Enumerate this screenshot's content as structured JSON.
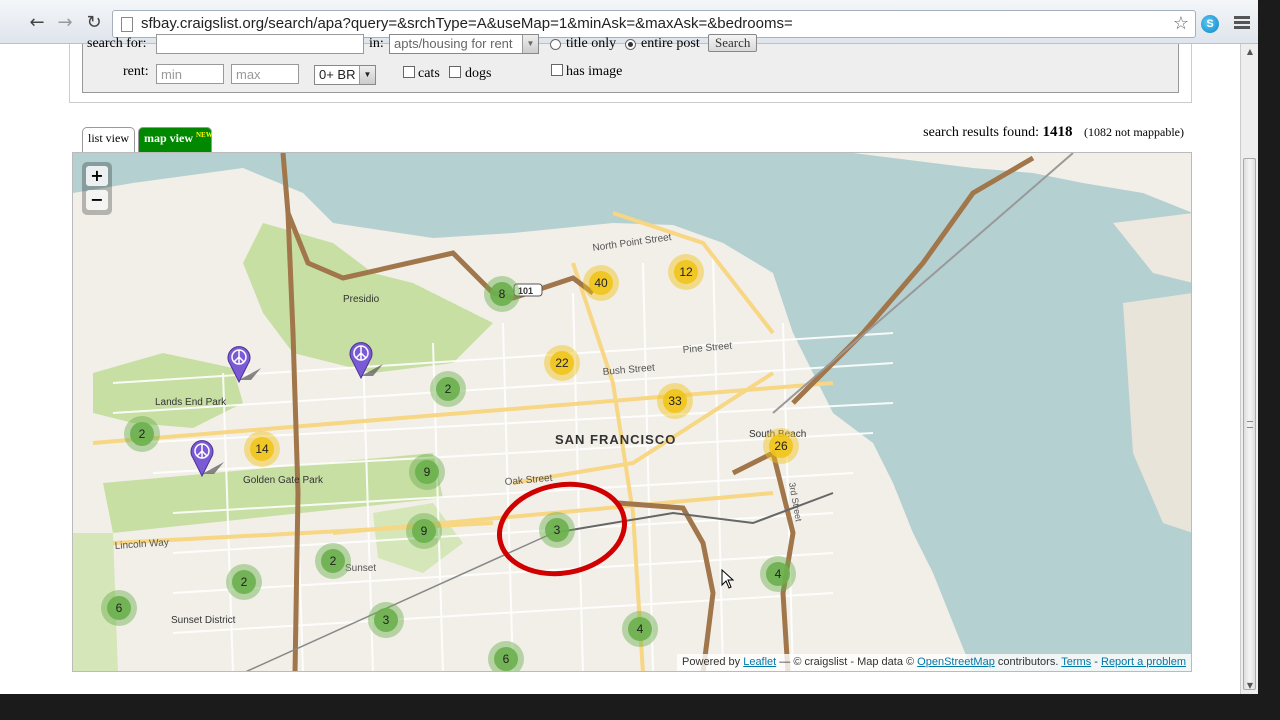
{
  "browser": {
    "url": "sfbay.craigslist.org/search/apa?query=&srchType=A&useMap=1&minAsk=&maxAsk=&bedrooms=",
    "skype_glyph": "S"
  },
  "search_form": {
    "search_for_label": "search for:",
    "in_label": "in:",
    "category_value": "apts/housing for rent",
    "title_only_label": "title only",
    "entire_post_label": "entire post",
    "search_button": "Search",
    "rent_label": "rent:",
    "min_placeholder": "min",
    "max_placeholder": "max",
    "bedrooms_value": "0+ BR",
    "cats_label": "cats",
    "dogs_label": "dogs",
    "has_image_label": "has image"
  },
  "tabs": {
    "list_view": "list view",
    "map_view": "map view",
    "new_badge": "NEW"
  },
  "results": {
    "prefix": "search results found:",
    "count": "1418",
    "unmappable": "(1082 not mappable)"
  },
  "map": {
    "zoom_in": "+",
    "zoom_out": "−",
    "city_label": "SAN FRANCISCO",
    "places": [
      {
        "name": "Presidio"
      },
      {
        "name": "Lands End Park"
      },
      {
        "name": "Golden Gate Park"
      },
      {
        "name": "Sunset District"
      },
      {
        "name": "South Beach"
      }
    ],
    "streets": [
      "North Point Street",
      "Pine Street",
      "Bush Street",
      "Oak Street",
      "Lincoln Way",
      "Sunset",
      "3rd Street",
      "101"
    ],
    "clusters": [
      {
        "count": 8,
        "size": "small"
      },
      {
        "count": 40,
        "size": "medium"
      },
      {
        "count": 12,
        "size": "medium"
      },
      {
        "count": 22,
        "size": "medium"
      },
      {
        "count": 2,
        "size": "small"
      },
      {
        "count": 33,
        "size": "medium"
      },
      {
        "count": 26,
        "size": "medium"
      },
      {
        "count": 2,
        "size": "small"
      },
      {
        "count": 14,
        "size": "medium"
      },
      {
        "count": 9,
        "size": "small"
      },
      {
        "count": 9,
        "size": "small"
      },
      {
        "count": 3,
        "size": "small"
      },
      {
        "count": 2,
        "size": "small"
      },
      {
        "count": 2,
        "size": "small"
      },
      {
        "count": 6,
        "size": "small"
      },
      {
        "count": 3,
        "size": "small"
      },
      {
        "count": 4,
        "size": "small"
      },
      {
        "count": 6,
        "size": "small"
      },
      {
        "count": 4,
        "size": "small"
      }
    ],
    "marker_count": 3,
    "colors": {
      "water": "#b5d0d0",
      "land": "#f2efe9",
      "park": "#c8dfa4",
      "cluster_small": "#6ab04c",
      "cluster_medium": "#f0c419",
      "highlight_ring": "#d00000",
      "marker": "#7b5ad6"
    },
    "attribution": {
      "powered_by": "Powered by",
      "leaflet": "Leaflet",
      "sep1": " — © craigslist - Map data © ",
      "osm": "OpenStreetMap",
      "contributors": " contributors. ",
      "terms": "Terms",
      "dash": " - ",
      "report": "Report a problem"
    }
  }
}
